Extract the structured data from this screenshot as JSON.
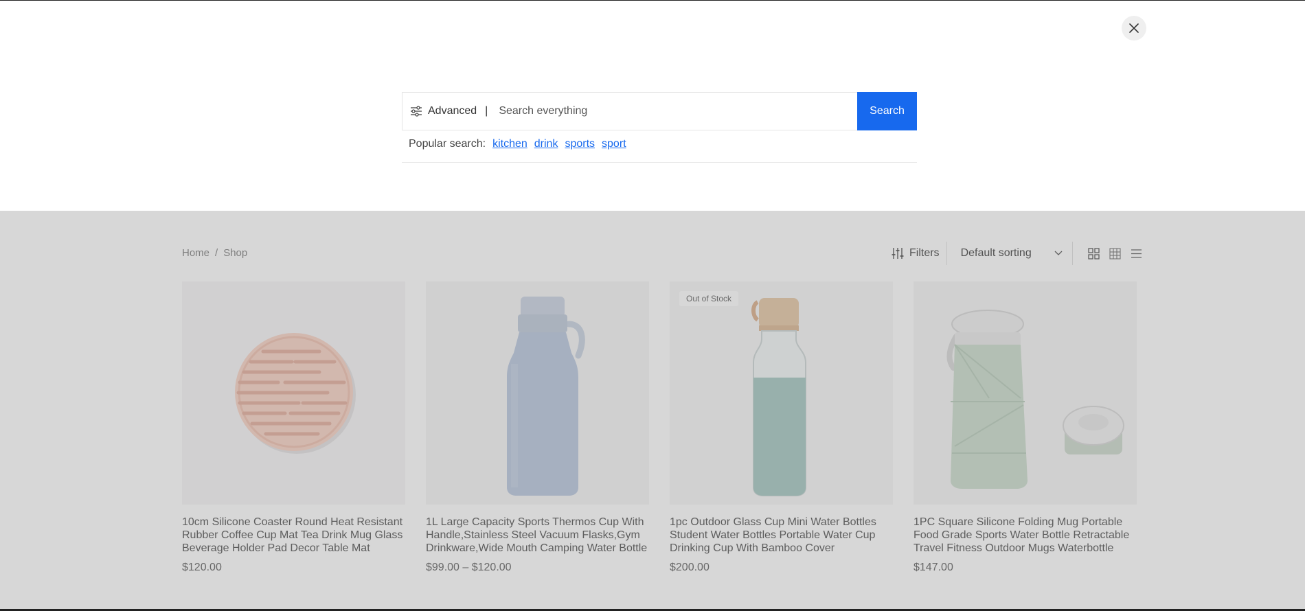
{
  "search": {
    "advanced_label": "Advanced",
    "separator": "|",
    "placeholder": "Search everything",
    "button_label": "Search",
    "popular_label": "Popular search:",
    "popular_terms": [
      "kitchen",
      "drink",
      "sports",
      "sport"
    ]
  },
  "breadcrumb": {
    "home": "Home",
    "sep": "/",
    "current": "Shop"
  },
  "toolbar": {
    "filters_label": "Filters",
    "sorting_value": "Default sorting"
  },
  "products": [
    {
      "title": "10cm Silicone Coaster Round Heat Resistant Rubber Coffee Cup Mat Tea Drink Mug Glass Beverage Holder Pad Decor Table Mat",
      "price": "$120.00",
      "badge": ""
    },
    {
      "title": "1L Large Capacity Sports Thermos Cup With Handle,Stainless Steel Vacuum Flasks,Gym Drinkware,Wide Mouth Camping Water Bottle",
      "price": "$99.00 – $120.00",
      "badge": ""
    },
    {
      "title": "1pc Outdoor Glass Cup Mini Water Bottles Student Water Bottles Portable Water Cup Drinking Cup With Bamboo Cover",
      "price": "$200.00",
      "badge": "Out of Stock"
    },
    {
      "title": "1PC Square Silicone Folding Mug Portable Food Grade Sports Water Bottle Retractable Travel Fitness Outdoor Mugs Waterbottle",
      "price": "$147.00",
      "badge": ""
    }
  ],
  "colors": {
    "accent": "#1769ee",
    "overlay": "#d8d8d8"
  }
}
